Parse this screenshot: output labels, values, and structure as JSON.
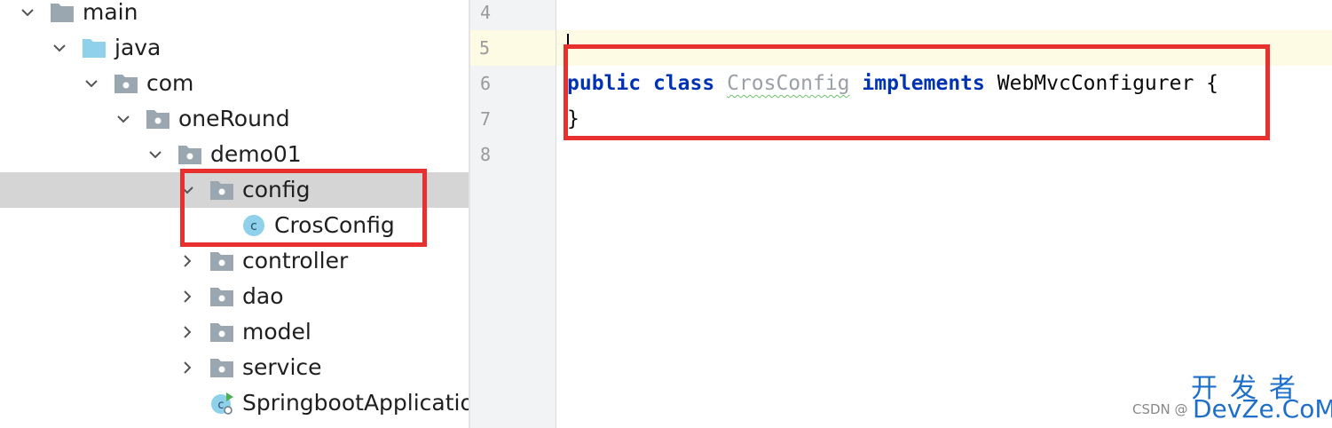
{
  "tree": {
    "items": [
      {
        "label": "main",
        "icon": "folder-icon",
        "expanded": true
      },
      {
        "label": "java",
        "icon": "source-folder-icon",
        "expanded": true
      },
      {
        "label": "com",
        "icon": "package-icon",
        "expanded": true
      },
      {
        "label": "oneRound",
        "icon": "package-icon",
        "expanded": true
      },
      {
        "label": "demo01",
        "icon": "package-icon",
        "expanded": true
      },
      {
        "label": "config",
        "icon": "package-icon",
        "expanded": true,
        "selected": true
      },
      {
        "label": "CrosConfig",
        "icon": "java-class-icon"
      },
      {
        "label": "controller",
        "icon": "package-icon",
        "expanded": false
      },
      {
        "label": "dao",
        "icon": "package-icon",
        "expanded": false
      },
      {
        "label": "model",
        "icon": "package-icon",
        "expanded": false
      },
      {
        "label": "service",
        "icon": "package-icon",
        "expanded": false
      },
      {
        "label": "SpringbootApplication",
        "icon": "spring-boot-class-icon"
      }
    ]
  },
  "editor": {
    "line_numbers": [
      "4",
      "5",
      "6",
      "7",
      "8"
    ],
    "code": {
      "kw_public": "public",
      "kw_class": "class",
      "class_name": "CrosConfig",
      "kw_implements": "implements",
      "interface_name": "WebMvcConfigurer",
      "open_brace": "{",
      "close_brace": "}"
    }
  },
  "watermark": {
    "chinese": "开发者",
    "english": "DevZe.CoM",
    "csdn": "CSDN @"
  },
  "colors": {
    "keyword": "#0033b3",
    "annotation_box": "#e8302f",
    "selection": "#d5d5d5",
    "caret_line": "#fdfbe4",
    "gutter": "#f2f3f5",
    "watermark": "#1e6fc9"
  }
}
